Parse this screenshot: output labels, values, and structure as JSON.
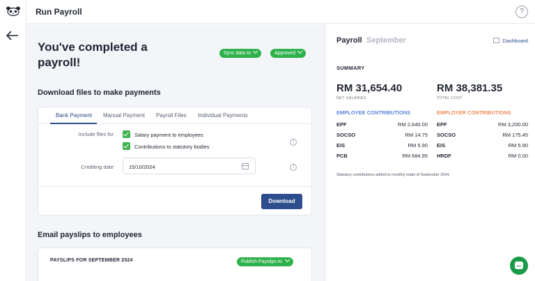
{
  "app": {
    "title": "Run Payroll"
  },
  "hero": {
    "title": "You've completed a payroll!",
    "sync_label": "Sync data to",
    "approved_label": "Approved"
  },
  "download": {
    "heading": "Download files to make payments",
    "tabs": [
      "Bank Payment",
      "Manual Payment",
      "Payroll Files",
      "Individual Payments"
    ],
    "include_label": "Include files for",
    "options": [
      "Salary payment to employees",
      "Contributions to statutory bodies"
    ],
    "crediting_label": "Crediting date",
    "crediting_value": "15/10/2024",
    "button": "Download"
  },
  "email": {
    "heading": "Email payslips to employees",
    "card_title": "PAYSLIPS FOR SEPTEMBER 2024",
    "publish_label": "Publish Payslips to"
  },
  "panel": {
    "title": "Payroll",
    "month": "September",
    "dashboard": "Dashboard",
    "summary": "SUMMARY",
    "net_value": "RM 31,654.40",
    "net_caption": "NET SALARIES",
    "total_value": "RM 38,381.35",
    "total_caption": "TOTAL COST",
    "employee_heading": "EMPLOYEE CONTRIBUTIONS",
    "employer_heading": "EMPLOYER CONTRIBUTIONS",
    "employee_rows": [
      {
        "k": "EPF",
        "v": "RM 2,640.00"
      },
      {
        "k": "SOCSO",
        "v": "RM 14.75"
      },
      {
        "k": "EIS",
        "v": "RM 5.90"
      },
      {
        "k": "PCB",
        "v": "RM 684.95"
      }
    ],
    "employer_rows": [
      {
        "k": "EPF",
        "v": "RM 3,200.00"
      },
      {
        "k": "SOCSO",
        "v": "RM 175.45"
      },
      {
        "k": "EIS",
        "v": "RM 5.90"
      },
      {
        "k": "HRDF",
        "v": "RM 0.00"
      }
    ],
    "note": "Statutory contributions added to monthly totals of September 2024."
  },
  "icons": {
    "logo": "panda-logo-icon",
    "back": "arrow-left-icon",
    "help": "question-icon",
    "info": "info-icon",
    "calendar": "calendar-icon",
    "dashboard": "dashboard-icon",
    "chat": "chat-icon"
  },
  "colors": {
    "accent": "#2d4d8c",
    "success": "#2fb24c",
    "employee": "#5a86d6",
    "employer": "#ee8c5a"
  }
}
